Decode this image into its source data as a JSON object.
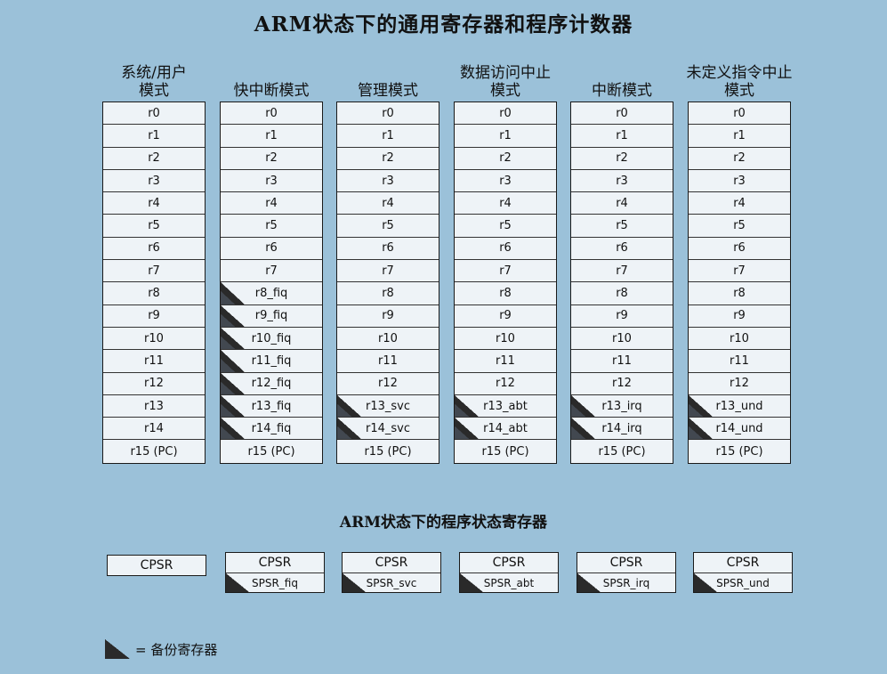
{
  "title": "ARM状态下的通用寄存器和程序计数器",
  "columns": [
    {
      "head": [
        "系统/用户",
        "模式"
      ],
      "regs": [
        "r0",
        "r1",
        "r2",
        "r3",
        "r4",
        "r5",
        "r6",
        "r7",
        "r8",
        "r9",
        "r10",
        "r11",
        "r12",
        "r13",
        "r14",
        "r15 (PC)"
      ],
      "banked_from": 99
    },
    {
      "head": [
        "快中断模式"
      ],
      "regs": [
        "r0",
        "r1",
        "r2",
        "r3",
        "r4",
        "r5",
        "r6",
        "r7",
        "r8_fiq",
        "r9_fiq",
        "r10_fiq",
        "r11_fiq",
        "r12_fiq",
        "r13_fiq",
        "r14_fiq",
        "r15 (PC)"
      ],
      "banked_from": 8
    },
    {
      "head": [
        "管理模式"
      ],
      "regs": [
        "r0",
        "r1",
        "r2",
        "r3",
        "r4",
        "r5",
        "r6",
        "r7",
        "r8",
        "r9",
        "r10",
        "r11",
        "r12",
        "r13_svc",
        "r14_svc",
        "r15 (PC)"
      ],
      "banked_from": 13
    },
    {
      "head": [
        "数据访问中止",
        "模式"
      ],
      "regs": [
        "r0",
        "r1",
        "r2",
        "r3",
        "r4",
        "r5",
        "r6",
        "r7",
        "r8",
        "r9",
        "r10",
        "r11",
        "r12",
        "r13_abt",
        "r14_abt",
        "r15 (PC)"
      ],
      "banked_from": 13
    },
    {
      "head": [
        "中断模式"
      ],
      "regs": [
        "r0",
        "r1",
        "r2",
        "r3",
        "r4",
        "r5",
        "r6",
        "r7",
        "r8",
        "r9",
        "r10",
        "r11",
        "r12",
        "r13_irq",
        "r14_irq",
        "r15 (PC)"
      ],
      "banked_from": 13
    },
    {
      "head": [
        "未定义指令中止",
        "模式"
      ],
      "regs": [
        "r0",
        "r1",
        "r2",
        "r3",
        "r4",
        "r5",
        "r6",
        "r7",
        "r8",
        "r9",
        "r10",
        "r11",
        "r12",
        "r13_und",
        "r14_und",
        "r15 (PC)"
      ],
      "banked_from": 13
    }
  ],
  "status_title": "ARM状态下的程序状态寄存器",
  "status_regs": [
    {
      "cpsr": "CPSR",
      "spsr": ""
    },
    {
      "cpsr": "CPSR",
      "spsr": "SPSR_fiq"
    },
    {
      "cpsr": "CPSR",
      "spsr": "SPSR_svc"
    },
    {
      "cpsr": "CPSR",
      "spsr": "SPSR_abt"
    },
    {
      "cpsr": "CPSR",
      "spsr": "SPSR_irq"
    },
    {
      "cpsr": "CPSR",
      "spsr": "SPSR_und"
    }
  ],
  "legend": {
    "text": "= 备份寄存器",
    "icon": "banked-register-triangle-icon"
  }
}
